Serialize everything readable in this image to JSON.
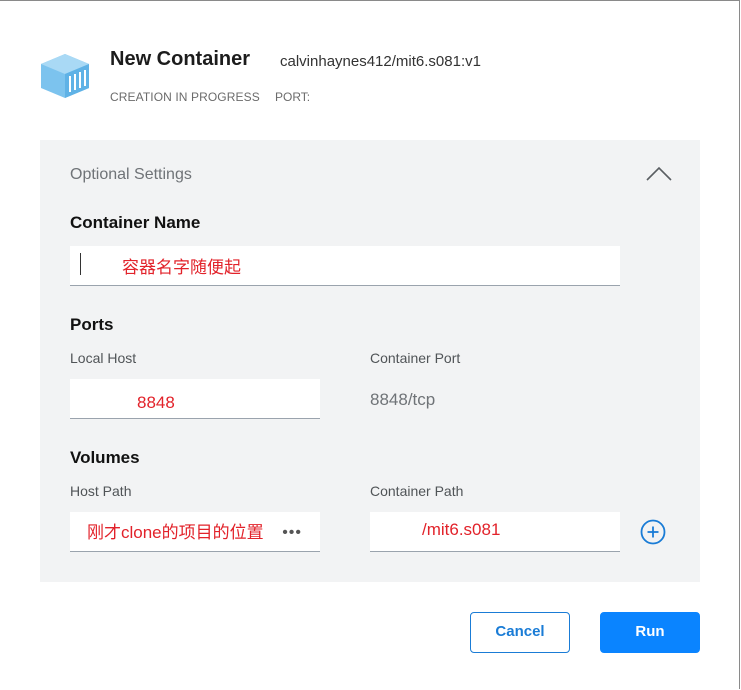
{
  "header": {
    "icon": "container-icon",
    "title": "New Container",
    "image_name": "calvinhaynes412/mit6.s081:v1",
    "status": "CREATION IN PROGRESS",
    "port_label": "PORT:"
  },
  "optional_settings": {
    "title": "Optional Settings",
    "collapse_icon": "chevron-up-icon",
    "container_name": {
      "label": "Container Name",
      "value": "容器名字随便起"
    },
    "ports": {
      "label": "Ports",
      "local_host_label": "Local Host",
      "local_host_value": "8848",
      "container_port_label": "Container Port",
      "container_port_value": "8848/tcp"
    },
    "volumes": {
      "label": "Volumes",
      "host_path_label": "Host Path",
      "host_path_value": "刚才clone的项目的位置",
      "more_icon": "ellipsis-icon",
      "container_path_label": "Container Path",
      "container_path_value": "/mit6.s081",
      "add_icon": "plus-circle-icon"
    }
  },
  "actions": {
    "cancel_label": "Cancel",
    "run_label": "Run"
  },
  "colors": {
    "accent": "#0a84ff",
    "annotation_red": "#e2222a",
    "panel_bg": "#f2f3f4",
    "icon_blue": "#7cc3ee"
  }
}
